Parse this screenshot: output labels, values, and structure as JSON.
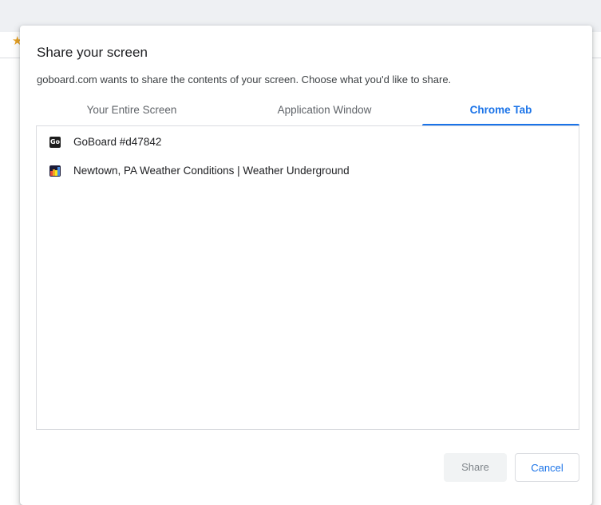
{
  "dialog": {
    "title": "Share your screen",
    "subtitle": "goboard.com wants to share the contents of your screen. Choose what you'd like to share."
  },
  "tabs": [
    {
      "label": "Your Entire Screen",
      "active": false
    },
    {
      "label": "Application Window",
      "active": false
    },
    {
      "label": "Chrome Tab",
      "active": true
    }
  ],
  "tab_list": [
    {
      "title": "GoBoard   #d47842",
      "favicon": "goboard-favicon",
      "favicon_text": "Go"
    },
    {
      "title": "Newtown, PA Weather Conditions | Weather Underground",
      "favicon": "weather-underground-favicon"
    }
  ],
  "buttons": {
    "share": "Share",
    "cancel": "Cancel"
  },
  "colors": {
    "accent": "#1a73e8",
    "background_star": "#e8a020"
  },
  "background_icons": [
    "star-icon"
  ]
}
